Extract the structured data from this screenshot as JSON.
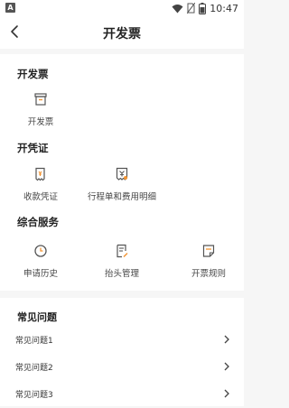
{
  "status_bar": {
    "time": "10:47",
    "left_badge": "A"
  },
  "header": {
    "title": "开发票"
  },
  "sections": [
    {
      "title": "开发票",
      "items": [
        {
          "label": "开发票",
          "icon": "invoice-box-icon"
        }
      ]
    },
    {
      "title": "开凭证",
      "items": [
        {
          "label": "收款凭证",
          "icon": "receipt-icon"
        },
        {
          "label": "行程单和费用明细",
          "icon": "itinerary-icon"
        }
      ]
    },
    {
      "title": "综合服务",
      "items": [
        {
          "label": "申请历史",
          "icon": "clock-icon"
        },
        {
          "label": "抬头管理",
          "icon": "header-edit-icon"
        },
        {
          "label": "开票规则",
          "icon": "rules-doc-icon"
        }
      ]
    }
  ],
  "faq": {
    "title": "常见问题",
    "items": [
      "常见问题1",
      "常见问题2",
      "常见问题3"
    ]
  },
  "colors": {
    "accent": "#f29433",
    "icon": "#555555",
    "background": "#f6f6f6"
  }
}
